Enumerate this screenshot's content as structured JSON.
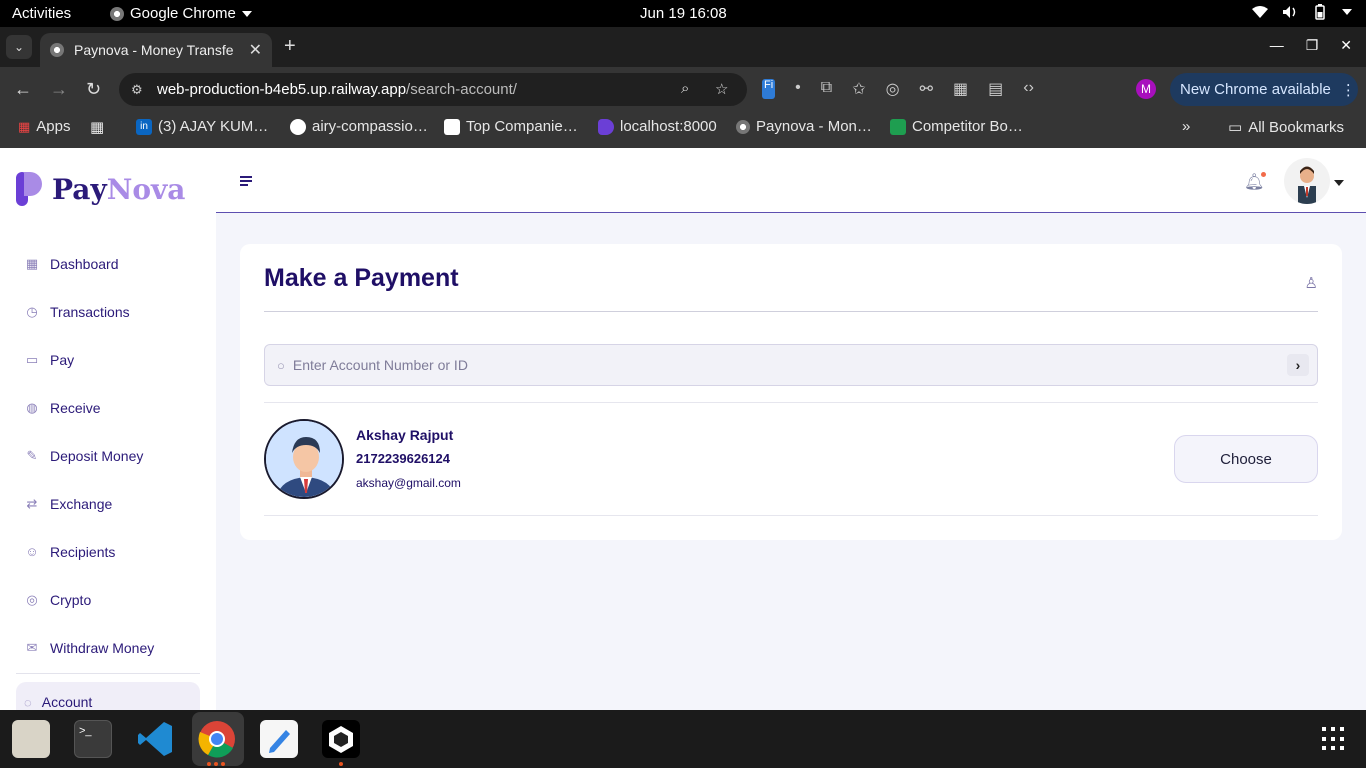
{
  "system": {
    "activities": "Activities",
    "app_name": "Google Chrome",
    "clock": "Jun 19  16:08"
  },
  "browser": {
    "tab_title": "Paynova - Money Transfe",
    "url_host": "web-production-b4eb5.up.railway.app",
    "url_path": "/search-account/",
    "profile_initial": "M",
    "update_label": "New Chrome available",
    "bookmarks": [
      "Apps",
      "(3) AJAY KUM…",
      "airy-compassio…",
      "Top Companie…",
      "localhost:8000",
      "Paynova - Mon…",
      "Competitor Bo…"
    ],
    "all_bookmarks": "All Bookmarks"
  },
  "brand": {
    "part1": "Pay",
    "part2": "Nova",
    "primary": "#2b1a79",
    "accent": "#a98be6"
  },
  "sidebar": {
    "items": [
      {
        "label": "Dashboard",
        "icon": "dashboard-icon"
      },
      {
        "label": "Transactions",
        "icon": "history-icon"
      },
      {
        "label": "Pay",
        "icon": "pay-icon"
      },
      {
        "label": "Receive",
        "icon": "receive-icon"
      },
      {
        "label": "Deposit Money",
        "icon": "deposit-icon"
      },
      {
        "label": "Exchange",
        "icon": "exchange-icon"
      },
      {
        "label": "Recipients",
        "icon": "user-icon"
      },
      {
        "label": "Crypto",
        "icon": "crypto-icon"
      },
      {
        "label": "Withdraw Money",
        "icon": "withdraw-icon"
      }
    ],
    "account": "Account"
  },
  "main": {
    "title": "Make a Payment",
    "search_placeholder": "Enter Account Number or ID",
    "result": {
      "name": "Akshay Rajput",
      "account_number": "2172239626124",
      "email": "akshay@gmail.com",
      "action": "Choose"
    }
  }
}
